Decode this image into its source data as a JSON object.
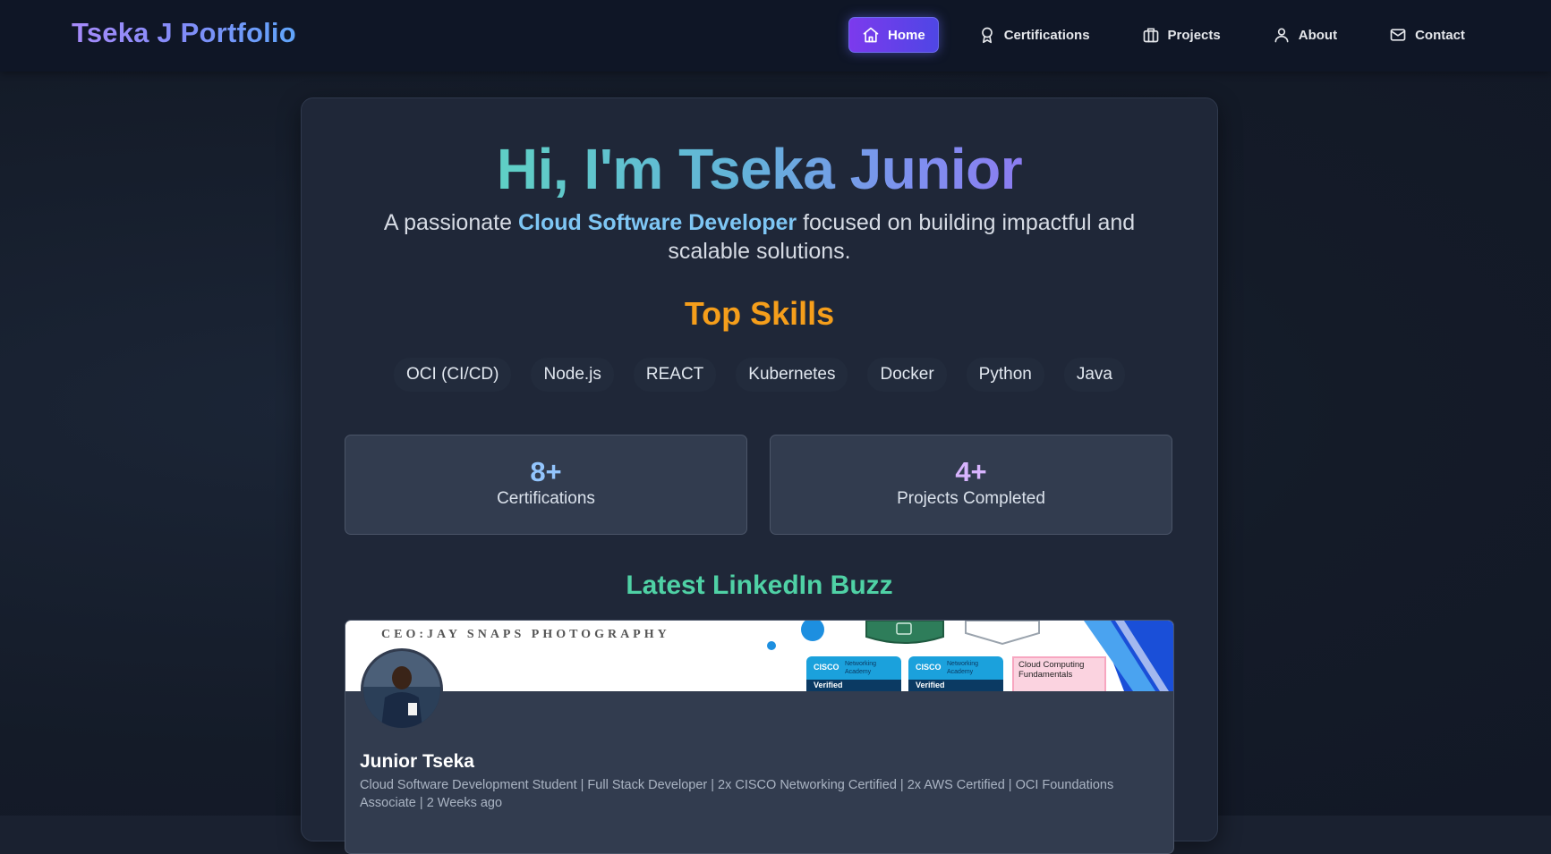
{
  "nav": {
    "brand": "Tseka J Portfolio",
    "links": [
      {
        "label": "Home",
        "icon": "home-icon",
        "active": true
      },
      {
        "label": "Certifications",
        "icon": "award-icon",
        "active": false
      },
      {
        "label": "Projects",
        "icon": "briefcase-icon",
        "active": false
      },
      {
        "label": "About",
        "icon": "user-icon",
        "active": false
      },
      {
        "label": "Contact",
        "icon": "mail-icon",
        "active": false
      }
    ]
  },
  "hero": {
    "greeting": "Hi, I'm Tseka Junior",
    "tagline_pre": "A passionate ",
    "tagline_highlight": "Cloud Software Developer",
    "tagline_post": " focused on building impactful and scalable solutions."
  },
  "skills": {
    "title": "Top Skills",
    "items": [
      "OCI (CI/CD)",
      "Node.js",
      "REACT",
      "Kubernetes",
      "Docker",
      "Python",
      "Java"
    ]
  },
  "stats": [
    {
      "value": "8+",
      "label": "Certifications"
    },
    {
      "value": "4+",
      "label": "Projects Completed"
    }
  ],
  "linkedin": {
    "title": "Latest LinkedIn Buzz",
    "banner_text": "CEO:JAY SNAPS PHOTOGRAPHY",
    "banner_badges": [
      {
        "label": "Networking Academy",
        "brand": "CISCO",
        "status": "Verified"
      },
      {
        "label": "Networking Academy",
        "brand": "CISCO",
        "status": "Verified"
      },
      {
        "label": "Cloud Computing Fundamentals"
      }
    ],
    "name": "Junior Tseka",
    "headline": "Cloud Software Development Student | Full Stack Developer | 2x CISCO Networking Certified | 2x AWS Certified | OCI Foundations Associate | 2 Weeks ago"
  },
  "colors": {
    "accent_purple": "#7c3aed",
    "accent_indigo": "#4f46e5",
    "skills_orange": "#f59e1b",
    "buzz_green": "#4fd1a5",
    "highlight_blue": "#7ec6f4"
  }
}
